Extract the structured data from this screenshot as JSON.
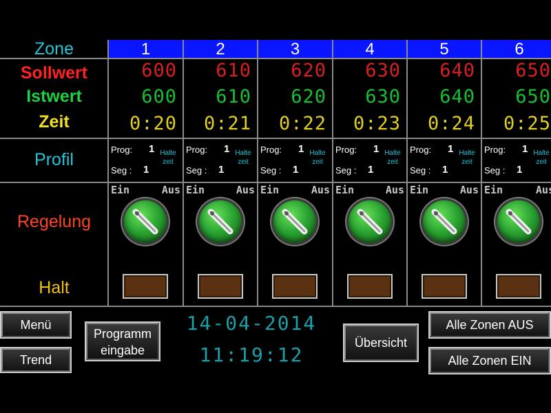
{
  "header": {
    "zone_label": "Zone"
  },
  "row_labels": {
    "sollwert": "Sollwert",
    "istwert": "Istwert",
    "zeit": "Zeit",
    "profil": "Profil",
    "regelung": "Regelung",
    "halt": "Halt"
  },
  "profile_labels": {
    "prog": "Prog:",
    "seg": "Seg :",
    "halte_line1": "Halte",
    "halte_line2": "zeit"
  },
  "switch_labels": {
    "ein": "Ein",
    "aus": "Aus"
  },
  "zones": [
    {
      "number": "1",
      "sollwert": "600",
      "istwert": "600",
      "zeit": "0:20",
      "prog": "1",
      "seg": "1"
    },
    {
      "number": "2",
      "sollwert": "610",
      "istwert": "610",
      "zeit": "0:21",
      "prog": "1",
      "seg": "1"
    },
    {
      "number": "3",
      "sollwert": "620",
      "istwert": "620",
      "zeit": "0:22",
      "prog": "1",
      "seg": "1"
    },
    {
      "number": "4",
      "sollwert": "630",
      "istwert": "630",
      "zeit": "0:23",
      "prog": "1",
      "seg": "1"
    },
    {
      "number": "5",
      "sollwert": "640",
      "istwert": "640",
      "zeit": "0:24",
      "prog": "1",
      "seg": "1"
    },
    {
      "number": "6",
      "sollwert": "650",
      "istwert": "650",
      "zeit": "0:25",
      "prog": "1",
      "seg": "1"
    }
  ],
  "buttons": {
    "menu": "Menü",
    "trend": "Trend",
    "programm_line1": "Programm",
    "programm_line2": "eingabe",
    "uebersicht": "Übersicht",
    "alle_aus": "Alle Zonen  AUS",
    "alle_ein": "Alle Zonen  EIN"
  },
  "clock": {
    "date": "14-04-2014",
    "time": "11:19:12"
  },
  "colors": {
    "header_blue": "#0a16ff",
    "sollwert": "#ff2222",
    "istwert": "#20d040",
    "zeit": "#f0e020",
    "profil": "#22c6d8",
    "regelung": "#ff4422",
    "halt": "#f0c020",
    "switch_green": "#2aa532",
    "halt_button": "#5a3212",
    "clock": "#1aa0a8"
  },
  "icons": {
    "switch": "rotary-switch-icon"
  }
}
